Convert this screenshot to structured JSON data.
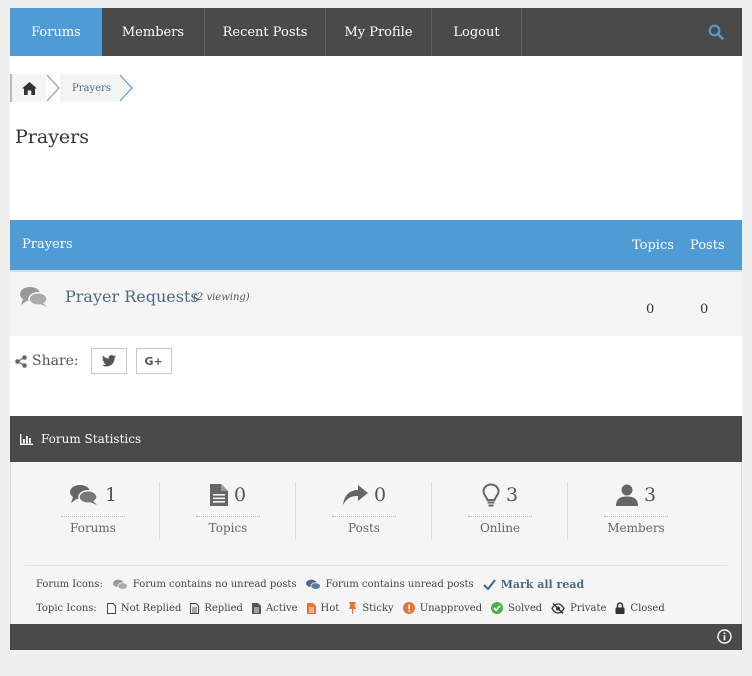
{
  "nav": {
    "items": [
      {
        "label": "Forums",
        "active": true
      },
      {
        "label": "Members"
      },
      {
        "label": "Recent Posts"
      },
      {
        "label": "My Profile"
      },
      {
        "label": "Logout"
      }
    ],
    "search_icon": "search-icon"
  },
  "breadcrumb": {
    "home_icon": "home-icon",
    "current": "Prayers"
  },
  "page": {
    "title": "Prayers"
  },
  "table": {
    "header": {
      "title": "Prayers",
      "topics": "Topics",
      "posts": "Posts"
    },
    "rows": [
      {
        "name": "Prayer Requests",
        "viewing": "(2 viewing)",
        "topics": "0",
        "posts": "0"
      }
    ]
  },
  "share": {
    "label": "Share:",
    "twitter_icon": "twitter-icon",
    "gplus_text": "G+"
  },
  "stats": {
    "title": "Forum Statistics",
    "items": [
      {
        "value": "1",
        "label": "Forums",
        "icon": "comments-icon"
      },
      {
        "value": "0",
        "label": "Topics",
        "icon": "file-icon"
      },
      {
        "value": "0",
        "label": "Posts",
        "icon": "reply-icon"
      },
      {
        "value": "3",
        "label": "Online",
        "icon": "lightbulb-icon"
      },
      {
        "value": "3",
        "label": "Members",
        "icon": "user-icon"
      }
    ],
    "forum_icons": {
      "label": "Forum Icons:",
      "no_unread": "Forum contains no unread posts",
      "unread": "Forum contains unread posts",
      "mark_all_read": "Mark all read"
    },
    "topic_icons": {
      "label": "Topic Icons:",
      "items": [
        "Not Replied",
        "Replied",
        "Active",
        "Hot",
        "Sticky",
        "Unapproved",
        "Solved",
        "Private",
        "Closed"
      ]
    }
  },
  "colors": {
    "accent": "#4e9bd6",
    "dark": "#4a4a4a",
    "link": "#4a6b88",
    "hot": "#e8733a",
    "solved": "#4caf50"
  }
}
